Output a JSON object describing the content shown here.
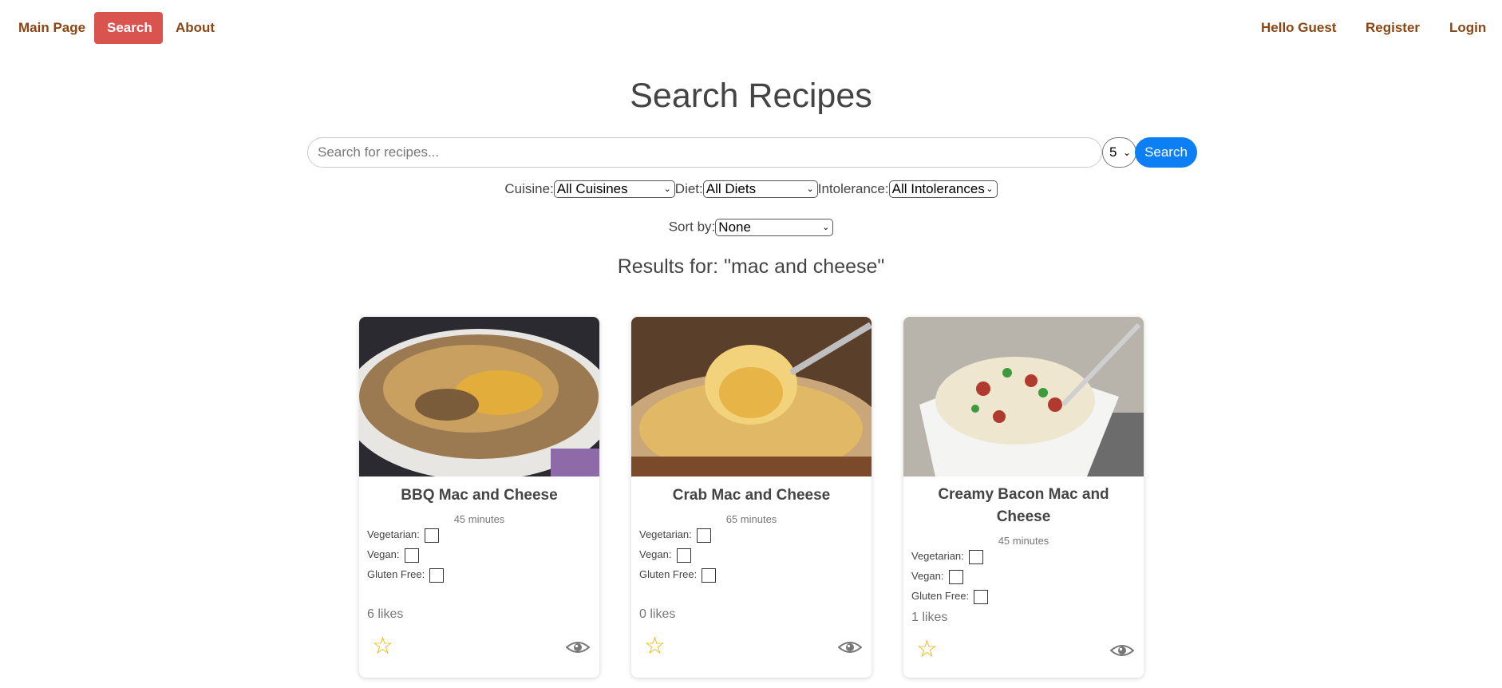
{
  "nav": {
    "main_page": "Main Page",
    "search": "Search",
    "about": "About",
    "greeting": "Hello Guest",
    "register": "Register",
    "login": "Login"
  },
  "page_title": "Search Recipes",
  "search": {
    "placeholder": "Search for recipes...",
    "count": "5",
    "button": "Search"
  },
  "filters": {
    "cuisine_label": "Cuisine:",
    "cuisine_value": "All Cuisines",
    "diet_label": "Diet:",
    "diet_value": "All Diets",
    "intolerance_label": "Intolerance:",
    "intolerance_value": "All Intolerances",
    "sort_label": "Sort by:",
    "sort_value": "None"
  },
  "results_heading": "Results for: \"mac and cheese\"",
  "recipes": [
    {
      "name": "BBQ Mac and Cheese",
      "time": "45 minutes",
      "vegetarian_label": "Vegetarian:",
      "vegan_label": "Vegan:",
      "gluten_free_label": "Gluten Free:",
      "likes": "6 likes"
    },
    {
      "name": "Crab Mac and Cheese",
      "time": "65 minutes",
      "vegetarian_label": "Vegetarian:",
      "vegan_label": "Vegan:",
      "gluten_free_label": "Gluten Free:",
      "likes": "0 likes"
    },
    {
      "name": "Creamy Bacon Mac and Cheese",
      "time": "45 minutes",
      "vegetarian_label": "Vegetarian:",
      "vegan_label": "Vegan:",
      "gluten_free_label": "Gluten Free:",
      "likes": "1 likes"
    }
  ],
  "colors": {
    "nav_link": "#8b4513",
    "nav_active_bg": "#d9534f",
    "search_button": "#0d7ff5",
    "star": "#f0b400"
  },
  "icons": {
    "favorite": "star-outline-icon",
    "view": "eye-icon"
  }
}
